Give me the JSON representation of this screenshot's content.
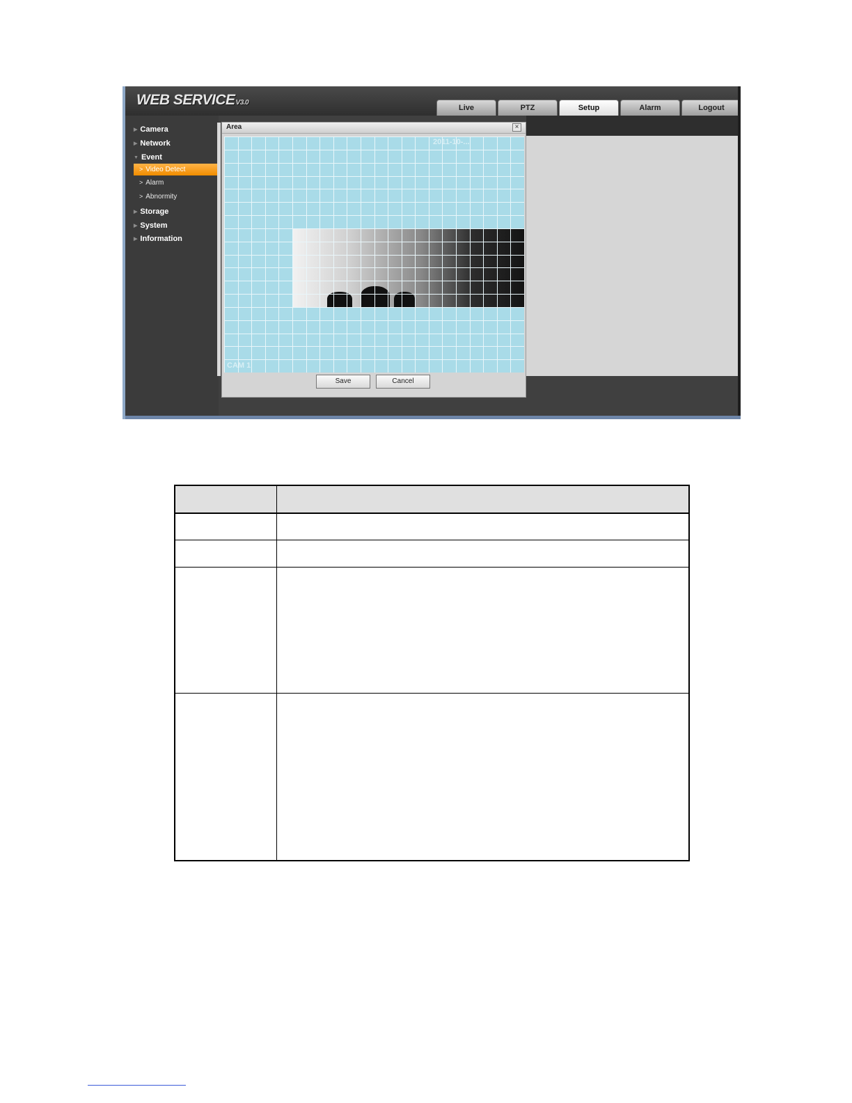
{
  "app": {
    "logo_text": "WEB  SERVICE",
    "logo_version": "V3.0"
  },
  "tabs": [
    {
      "label": "Live"
    },
    {
      "label": "PTZ"
    },
    {
      "label": "Setup"
    },
    {
      "label": "Alarm"
    },
    {
      "label": "Logout"
    }
  ],
  "active_tab": "Setup",
  "sidebar": {
    "items": [
      {
        "label": "Camera"
      },
      {
        "label": "Network"
      },
      {
        "label": "Event"
      },
      {
        "label": "Storage"
      },
      {
        "label": "System"
      },
      {
        "label": "Information"
      }
    ],
    "event_subitems": [
      {
        "label": "Video Detect"
      },
      {
        "label": "Alarm"
      },
      {
        "label": "Abnormity"
      }
    ],
    "active_subitem": "Video Detect"
  },
  "dialog": {
    "title": "Area",
    "close_glyph": "×",
    "grid": {
      "columns": 22,
      "rows": 18
    },
    "overlay_top": "2011-10-...",
    "overlay_bottom": "CAM 1",
    "save_label": "Save",
    "cancel_label": "Cancel"
  },
  "colors": {
    "accent": "#f08c00",
    "grid_fill": "#a9dbe8",
    "chrome_dark": "#404040"
  },
  "icons": {
    "collapsed": "right-triangle-icon",
    "expanded": "down-triangle-icon",
    "sub": "chevron-right-icon",
    "close": "close-icon"
  }
}
